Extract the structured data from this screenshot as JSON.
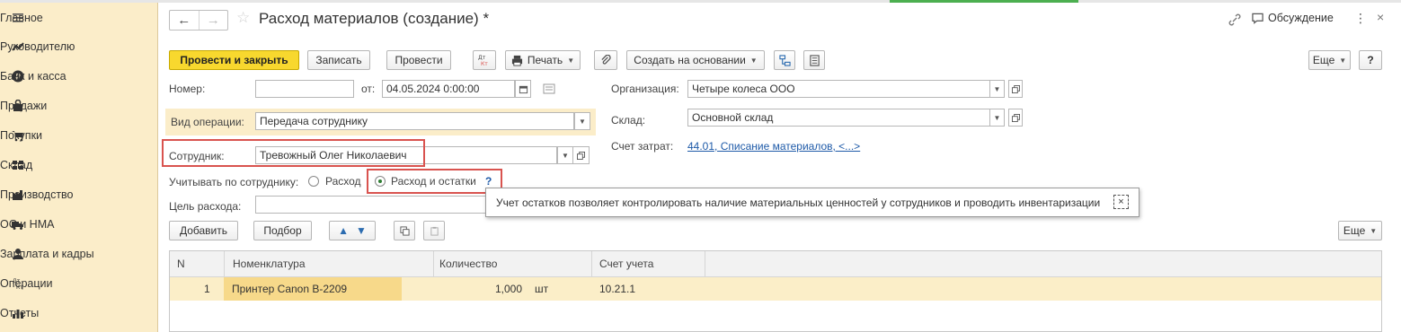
{
  "colors": {
    "sidebar_bg": "#fbedc9",
    "primary_btn": "#f8d82e",
    "highlight_row": "#fbeec8",
    "red_box": "#d9534f",
    "link": "#1e5aa8"
  },
  "sidebar": {
    "items": [
      {
        "label": "Главное",
        "icon": "menu-icon"
      },
      {
        "label": "Руководителю",
        "icon": "trend-icon"
      },
      {
        "label": "Банк и касса",
        "icon": "ruble-icon"
      },
      {
        "label": "Продажи",
        "icon": "bag-icon"
      },
      {
        "label": "Покупки",
        "icon": "cart-icon"
      },
      {
        "label": "Склад",
        "icon": "warehouse-icon"
      },
      {
        "label": "Производство",
        "icon": "factory-icon"
      },
      {
        "label": "ОС и НМА",
        "icon": "truck-icon"
      },
      {
        "label": "Зарплата и кадры",
        "icon": "person-icon"
      },
      {
        "label": "Операции",
        "icon": "dt-kt-icon"
      },
      {
        "label": "Отчеты",
        "icon": "bar-chart-icon"
      }
    ]
  },
  "header": {
    "title": "Расход материалов (создание) *",
    "discussion": "Обсуждение",
    "more_dots": "⋮",
    "close": "×"
  },
  "toolbar": {
    "post_close": "Провести и закрыть",
    "save": "Записать",
    "post": "Провести",
    "dtkt": "Дт Кт",
    "print": "Печать",
    "create_based": "Создать на основании",
    "more": "Еще",
    "help": "?"
  },
  "form": {
    "number_label": "Номер:",
    "number_value": "",
    "from_label": "от:",
    "date_value": "04.05.2024  0:00:00",
    "org_label": "Организация:",
    "org_value": "Четыре колеса ООО",
    "optype_label": "Вид операции:",
    "optype_value": "Передача сотруднику",
    "warehouse_label": "Склад:",
    "warehouse_value": "Основной склад",
    "employee_label": "Сотрудник:",
    "employee_value": "Тревожный Олег Николаевич",
    "cost_account_label": "Счет затрат:",
    "cost_account_value": "44.01, Списание материалов, <...>",
    "track_label": "Учитывать по сотруднику:",
    "radio_expense": "Расход",
    "radio_expense_balance": "Расход и остатки",
    "help_mark": "?",
    "purpose_label": "Цель расхода:",
    "purpose_value": ""
  },
  "tooltip": {
    "text": "Учет остатков позволяет контролировать наличие материальных ценностей у сотрудников и проводить инвентаризации",
    "close": "×"
  },
  "table_toolbar": {
    "add": "Добавить",
    "select": "Подбор",
    "more": "Еще"
  },
  "table": {
    "columns": [
      "N",
      "Номенклатура",
      "Количество",
      "Счет учета"
    ],
    "rows": [
      {
        "n": "1",
        "item": "Принтер Canon B-2209",
        "qty": "1,000",
        "unit": "шт",
        "account": "10.21.1"
      }
    ]
  }
}
